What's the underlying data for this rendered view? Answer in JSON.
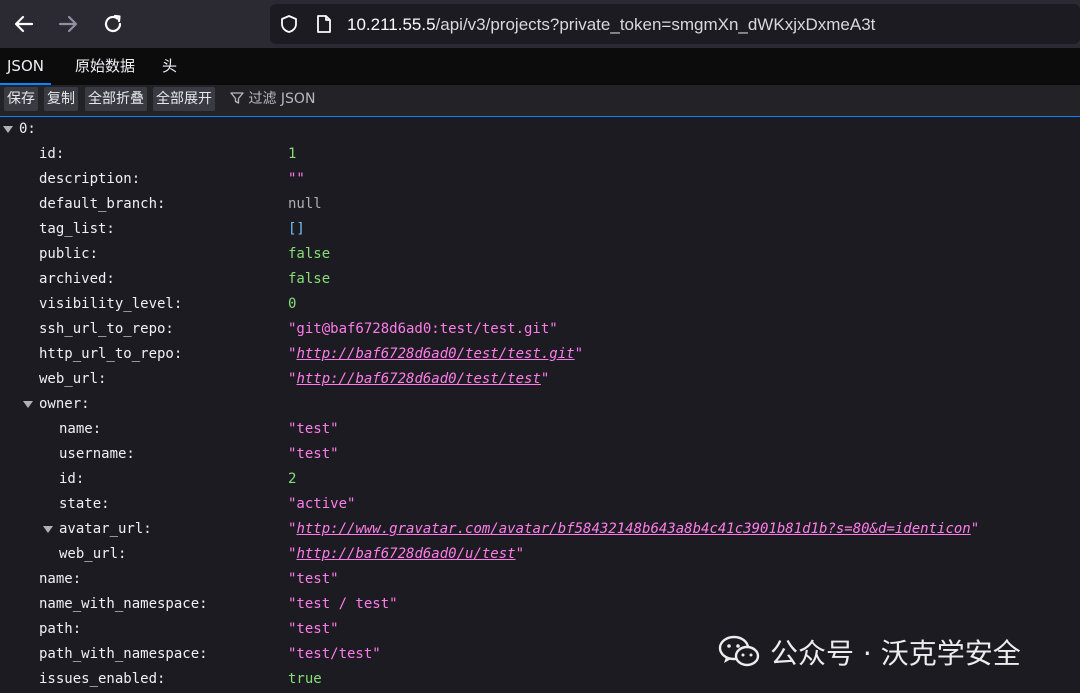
{
  "browser": {
    "url_host": "10.211.55.5",
    "url_path": "/api/v3/projects?private_token=smgmXn_dWKxjxDxmeA3t",
    "icons": [
      "back-arrow-icon",
      "forward-arrow-icon",
      "reload-icon",
      "shield-icon",
      "page-icon"
    ]
  },
  "viewer_tabs": [
    "JSON",
    "原始数据",
    "头"
  ],
  "actions": {
    "save": "保存",
    "copy": "复制",
    "collapse_all": "全部折叠",
    "expand_all": "全部展开",
    "filter_placeholder": "过滤 JSON"
  },
  "tree": {
    "root_label": "0:",
    "rows": [
      {
        "key": "id:",
        "value": "1"
      },
      {
        "key": "description:",
        "value": "\"\""
      },
      {
        "key": "default_branch:",
        "value": "null"
      },
      {
        "key": "tag_list:",
        "value": "[]"
      },
      {
        "key": "public:",
        "value": "false"
      },
      {
        "key": "archived:",
        "value": "false"
      },
      {
        "key": "visibility_level:",
        "value": "0"
      },
      {
        "key": "ssh_url_to_repo:",
        "value": "\"git@baf6728d6ad0:test/test.git\""
      },
      {
        "key": "http_url_to_repo:",
        "value": "http://baf6728d6ad0/test/test.git"
      },
      {
        "key": "web_url:",
        "value": "http://baf6728d6ad0/test/test"
      },
      {
        "key": "owner:",
        "value": ""
      },
      {
        "key": "name:",
        "value": "\"test\""
      },
      {
        "key": "username:",
        "value": "\"test\""
      },
      {
        "key": "id:",
        "value": "2"
      },
      {
        "key": "state:",
        "value": "\"active\""
      },
      {
        "key": "avatar_url:",
        "value": "http://www.gravatar.com/avatar/bf58432148b643a8b4c41c3901b81d1b?s=80&d=identicon"
      },
      {
        "key": "web_url:",
        "value": "http://baf6728d6ad0/u/test"
      },
      {
        "key": "name:",
        "value": "\"test\""
      },
      {
        "key": "name_with_namespace:",
        "value": "\"test / test\""
      },
      {
        "key": "path:",
        "value": "\"test\""
      },
      {
        "key": "path_with_namespace:",
        "value": "\"test/test\""
      },
      {
        "key": "issues_enabled:",
        "value": "true"
      }
    ]
  },
  "watermark": "公众号 · 沃克学安全"
}
